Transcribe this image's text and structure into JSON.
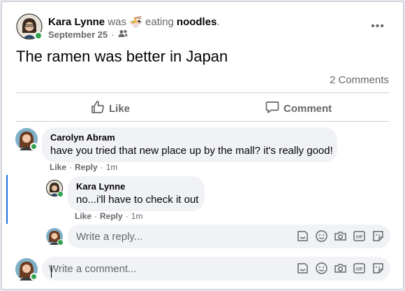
{
  "post": {
    "author": "Kara Lynne",
    "was_text": "was",
    "activity_emoji": "🍜",
    "activity_text": "eating",
    "activity_object": "noodles",
    "activity_suffix": ".",
    "date": "September 25",
    "privacy_separator": "·",
    "audience_icon": "friends-icon",
    "more_icon": "more-options-icon",
    "more_label": "•••",
    "text": "The ramen was better in Japan",
    "comment_count": "2 Comments"
  },
  "actions": {
    "like_label": "Like",
    "like_icon": "thumbs-up-icon",
    "comment_label": "Comment",
    "comment_icon": "comment-bubble-icon"
  },
  "comments": [
    {
      "author": "Carolyn Abram",
      "text": "have you tried that new place up by the mall? it's really good!",
      "like_label": "Like",
      "reply_label": "Reply",
      "time": "1m",
      "sep": "·"
    }
  ],
  "replies": [
    {
      "author": "Kara Lynne",
      "text": "no...i'll have to check it out",
      "like_label": "Like",
      "reply_label": "Reply",
      "time": "1m",
      "sep": "·"
    }
  ],
  "reply_input": {
    "placeholder": "Write a reply..."
  },
  "comment_input": {
    "placeholder": "Write a comment..."
  },
  "input_icons": [
    "sticker-icon",
    "emoji-icon",
    "camera-icon",
    "gif-icon",
    "sticker-pack-icon"
  ],
  "colors": {
    "online": "#31a24c",
    "accent": "#1b74e4",
    "muted": "#65676b",
    "bubble": "#f0f2f5"
  }
}
